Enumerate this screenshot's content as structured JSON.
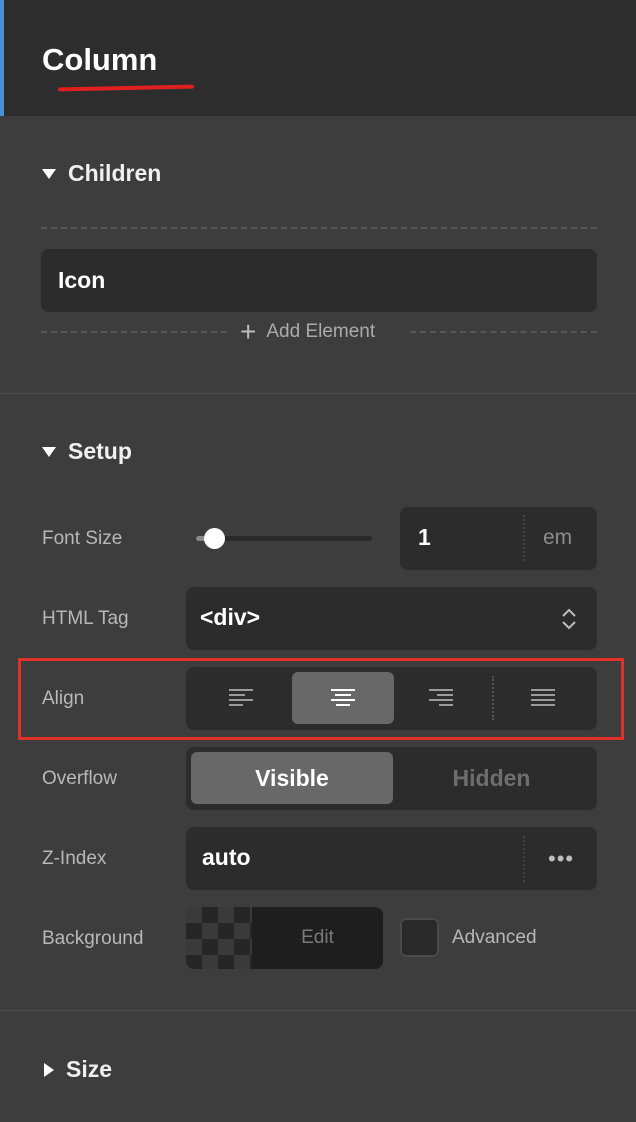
{
  "header": {
    "title": "Column"
  },
  "children": {
    "section_label": "Children",
    "items": [
      "Icon"
    ],
    "add_label": "Add Element"
  },
  "setup": {
    "section_label": "Setup",
    "font_size": {
      "label": "Font Size",
      "value": "1",
      "unit": "em",
      "slider_fraction": 0.1
    },
    "html_tag": {
      "label": "HTML Tag",
      "value": "<div>"
    },
    "align": {
      "label": "Align",
      "options": [
        "align-left",
        "align-center",
        "align-right",
        "align-justify"
      ],
      "selected": "align-center"
    },
    "overflow": {
      "label": "Overflow",
      "options": [
        "Visible",
        "Hidden"
      ],
      "selected": "Visible"
    },
    "z_index": {
      "label": "Z-Index",
      "value": "auto"
    },
    "background": {
      "label": "Background",
      "edit_label": "Edit",
      "advanced_label": "Advanced"
    }
  },
  "size": {
    "section_label": "Size"
  },
  "colors": {
    "accent": "#4a90d9",
    "annotation": "#e0322a",
    "panel_bg": "#3d3d3d",
    "control_bg": "#2c2c2c"
  }
}
